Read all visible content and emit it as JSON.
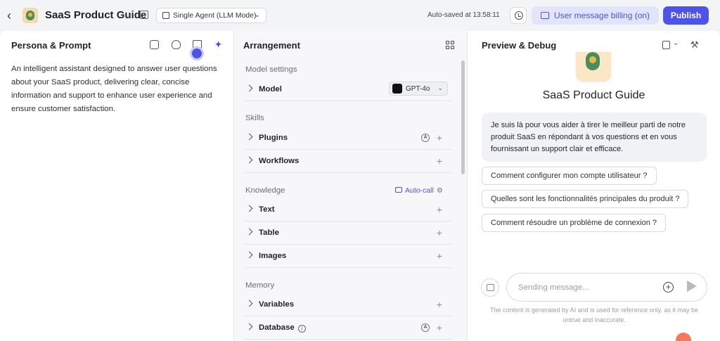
{
  "header": {
    "back_icon": "chevron-left-icon",
    "app_title": "SaaS Product Guide",
    "mode": "Single Agent (LLM Mode)",
    "autosave": "Auto-saved at 13:58:11",
    "billing_label": "User message billing (on)",
    "publish_label": "Publish",
    "accent_color": "#4d53e8"
  },
  "persona": {
    "title": "Persona & Prompt",
    "text": "An intelligent assistant designed to answer user questions about your SaaS product, delivering clear, concise information and support to enhance user experience and ensure customer satisfaction."
  },
  "arrangement": {
    "title": "Arrangement",
    "model_section": "Model settings",
    "model_label": "Model",
    "model_value": "GPT-4o",
    "skills_section": "Skills",
    "plugins_label": "Plugins",
    "workflows_label": "Workflows",
    "knowledge_section": "Knowledge",
    "autocall_label": "Auto-call",
    "text_label": "Text",
    "table_label": "Table",
    "images_label": "Images",
    "memory_section": "Memory",
    "variables_label": "Variables",
    "database_label": "Database",
    "auto_badge": "A",
    "plus": "+"
  },
  "preview": {
    "title": "Preview & Debug",
    "bot_name": "SaaS Product Guide",
    "bot_message": "Je suis là pour vous aider à tirer le meilleur parti de notre produit SaaS en répondant à vos questions et en vous fournissant un support clair et efficace.",
    "suggestions": [
      "Comment configurer mon compte utilisateur ?",
      "Quelles sont les fonctionnalités principales du produit ?",
      "Comment résoudre un problème de connexion ?"
    ],
    "input_placeholder": "Sending message...",
    "disclaimer": "The content is generated by AI and is used for reference only, as it may be untrue and inaccurate."
  }
}
